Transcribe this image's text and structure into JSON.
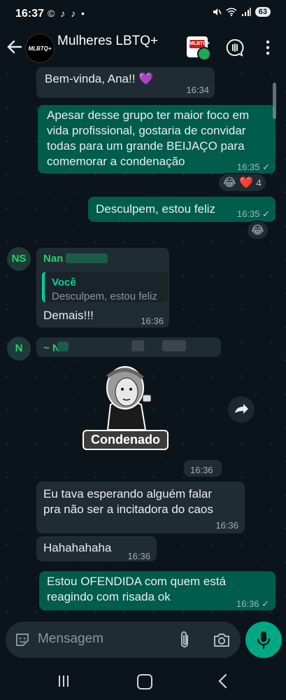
{
  "status_bar": {
    "time": "16:37",
    "left_icons": "© ♪ ♪ •",
    "battery": "63"
  },
  "header": {
    "group_avatar_text": "MLBTQ+",
    "group_name": "Mulheres LBTQ+",
    "meet_icon_text": "MLBTQ+"
  },
  "messages": [
    {
      "id": "m1",
      "text": "Bem-vinda, Ana!! 💜",
      "time": "16:34",
      "direction": "in"
    },
    {
      "id": "m2",
      "lines": [
        "Apesar desse grupo ter maior foco em",
        "vida profissional, gostaria de convidar",
        "todas para um grande BEIJAÇO para",
        "comemorar a condenação"
      ],
      "time": "16:35",
      "direction": "out",
      "reaction": {
        "emojis": "😂 ❤️",
        "count": "4"
      }
    },
    {
      "id": "m3",
      "text": "Desculpem, estou feliz",
      "time": "16:35",
      "direction": "out",
      "reaction": {
        "emojis": "😂"
      }
    },
    {
      "id": "m4",
      "avatar": "NS",
      "sender": "Nan",
      "quote_author": "Você",
      "quote_text": "Desculpem, estou feliz",
      "text": "Demais!!!",
      "time": "16:36",
      "direction": "in"
    },
    {
      "id": "m5",
      "avatar": "N",
      "sender": "~ Na",
      "direction": "in"
    },
    {
      "id": "m6",
      "sticker_label": "Condenado",
      "time": "16:36",
      "direction": "in"
    },
    {
      "id": "m7",
      "lines": [
        "Eu tava esperando alguém falar",
        "pra não ser a incitadora do caos"
      ],
      "time": "16:36",
      "direction": "in"
    },
    {
      "id": "m8",
      "text": "Hahahahaha",
      "time": "16:36",
      "direction": "in"
    },
    {
      "id": "m9",
      "lines": [
        "Estou OFENDIDA com quem está",
        "reagindo com risada ok"
      ],
      "time": "16:36",
      "direction": "out"
    }
  ],
  "composer": {
    "placeholder": "Mensagem"
  },
  "icons": [
    "back-arrow-icon",
    "video-call-icon",
    "call-add-icon",
    "more-vert-icon",
    "sticker-icon",
    "attach-icon",
    "camera-icon",
    "mic-icon",
    "forward-icon",
    "double-check-icon"
  ],
  "colors": {
    "background": "#0b141a",
    "incoming": "#202c33",
    "outgoing": "#005c4b",
    "accent": "#00a884",
    "sender_name": "#25d366"
  }
}
